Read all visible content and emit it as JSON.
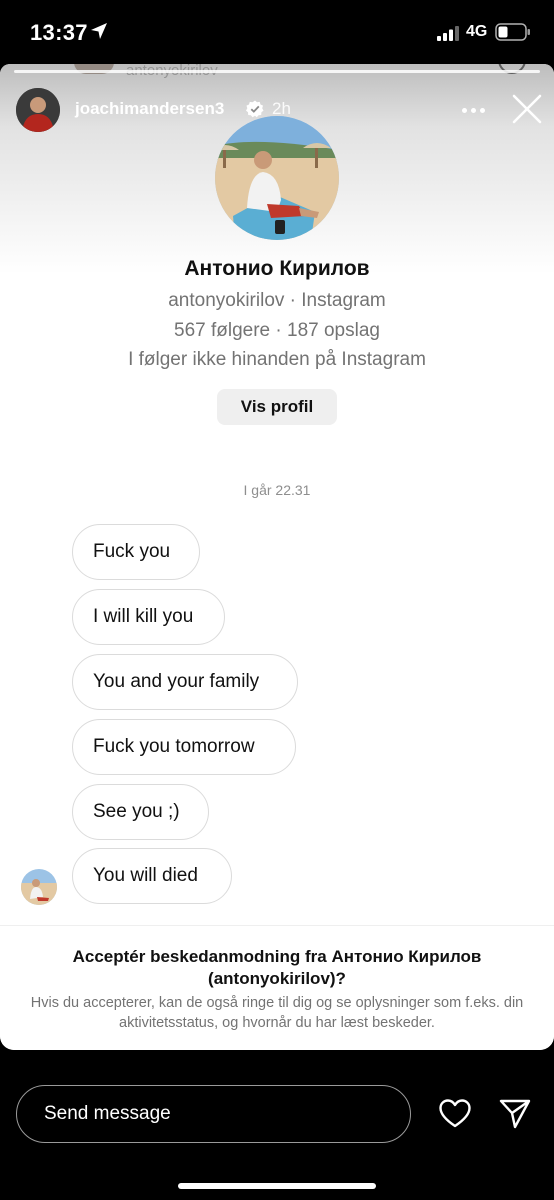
{
  "status_bar": {
    "time": "13:37",
    "network": "4G",
    "icons": [
      "location-arrow-icon",
      "signal-icon",
      "battery-icon"
    ]
  },
  "story": {
    "previous_username": "antonyokirilov",
    "username": "joachimandersen3",
    "verified": true,
    "posted_ago": "2h"
  },
  "profile": {
    "name": "Антонио Кирилов",
    "handle_line": "antonyokirilov · Instagram",
    "stats_line": "567 følgere · 187 opslag",
    "relation_line": "I følger ikke hinanden på Instagram",
    "view_profile_label": "Vis profil"
  },
  "conversation": {
    "timestamp": "I går 22.31",
    "messages": [
      "Fuck you",
      "I will kill you",
      "You and your family",
      "Fuck you tomorrow",
      "See you ;)",
      "You will died"
    ]
  },
  "request": {
    "title": "Acceptér beskedanmodning fra Антонио Кирилов (antonyokirilov)?",
    "body": "Hvis du accepterer, kan de også ringe til dig og se oplysninger som f.eks. din aktivitetsstatus, og hvornår du har læst beskeder."
  },
  "composer": {
    "placeholder": "Send message"
  },
  "colors": {
    "background": "#000000",
    "card": "#ffffff",
    "secondary_text": "#737373",
    "bubble_border": "#dbdbdb",
    "button_bg": "#efefef"
  }
}
